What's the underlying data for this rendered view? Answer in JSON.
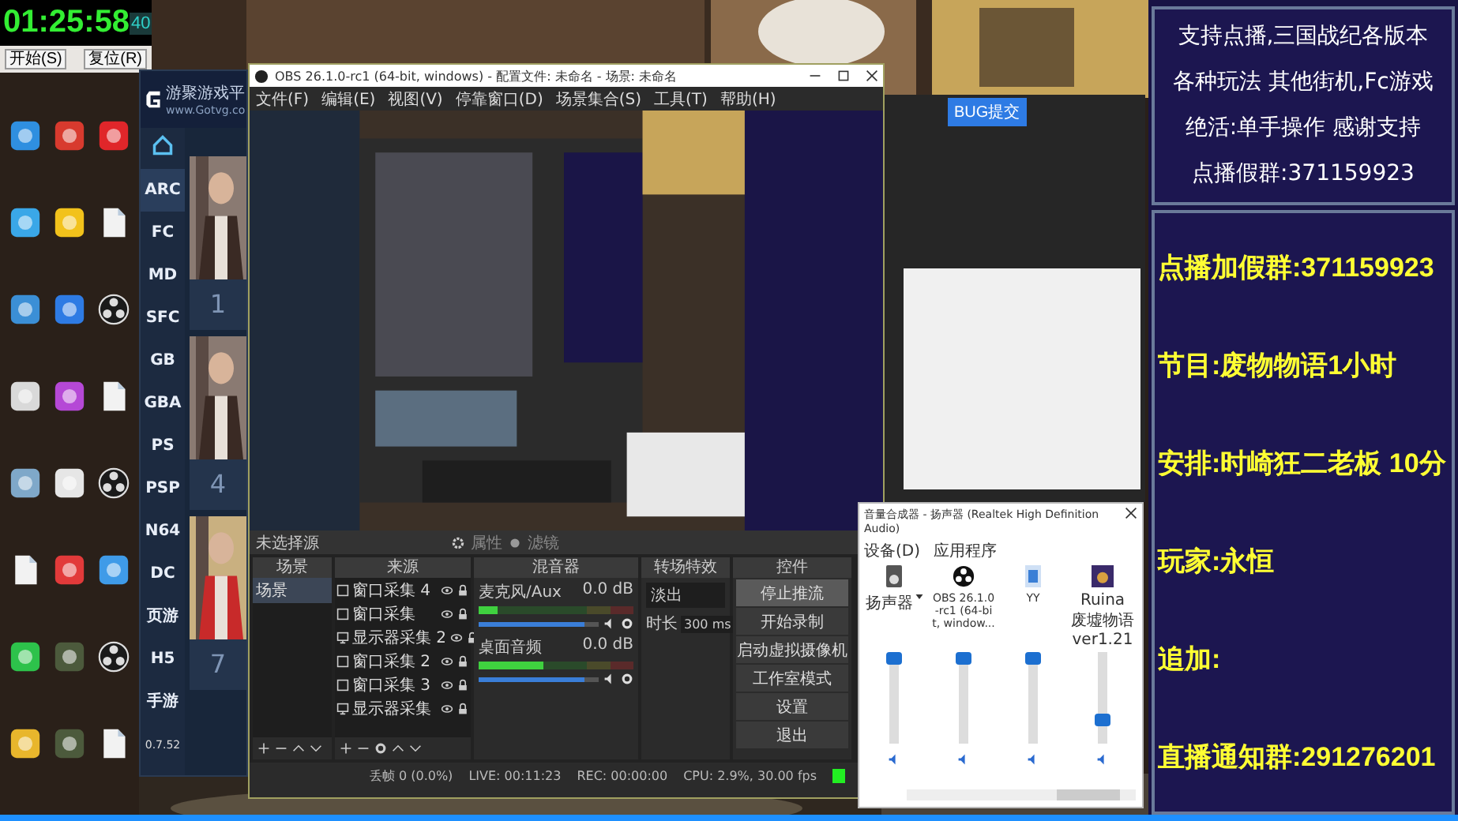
{
  "timer": {
    "time": "01:25:58",
    "count": "40",
    "buttons": [
      "开始(S)",
      "复位(R)"
    ]
  },
  "desktop_icons": [
    {
      "kind": "app",
      "color": "#2f8fe0"
    },
    {
      "kind": "app",
      "color": "#d83a2e"
    },
    {
      "kind": "app",
      "color": "#e0262a"
    },
    {
      "kind": "app",
      "color": "#3aa7e8"
    },
    {
      "kind": "app",
      "color": "#f2c21b"
    },
    {
      "kind": "doc"
    },
    {
      "kind": "app",
      "color": "#3b8fd6"
    },
    {
      "kind": "app",
      "color": "#2e7be4"
    },
    {
      "kind": "obs"
    },
    {
      "kind": "app",
      "color": "#d9d9d9"
    },
    {
      "kind": "app",
      "color": "#b548d6"
    },
    {
      "kind": "doc"
    },
    {
      "kind": "app",
      "color": "#7fa8c9"
    },
    {
      "kind": "app",
      "color": "#e6e6e6"
    },
    {
      "kind": "obs"
    },
    {
      "kind": "doc"
    },
    {
      "kind": "app",
      "color": "#e23a3a"
    },
    {
      "kind": "app",
      "color": "#3f9be8"
    },
    {
      "kind": "app",
      "color": "#2dc24b"
    },
    {
      "kind": "app",
      "color": "#4c5a3c"
    },
    {
      "kind": "obs"
    },
    {
      "kind": "app",
      "color": "#e8b62c"
    },
    {
      "kind": "app",
      "color": "#4c5a3c"
    },
    {
      "kind": "doc"
    }
  ],
  "launcher": {
    "title": "游聚游戏平",
    "url": "www.Gotvg.co",
    "nav": [
      {
        "label": "ARC",
        "selected": true
      },
      {
        "label": "FC",
        "selected": false
      },
      {
        "label": "MD",
        "selected": false
      },
      {
        "label": "SFC",
        "selected": false
      },
      {
        "label": "GB",
        "selected": false
      },
      {
        "label": "GBA",
        "selected": false
      },
      {
        "label": "PS",
        "selected": false
      },
      {
        "label": "PSP",
        "selected": false
      },
      {
        "label": "N64",
        "selected": false
      },
      {
        "label": "DC",
        "selected": false
      },
      {
        "label": "页游",
        "selected": false
      },
      {
        "label": "H5",
        "selected": false
      },
      {
        "label": "手游",
        "selected": false
      }
    ],
    "version": "0.7.52",
    "cards": [
      {
        "number": "1"
      },
      {
        "number": "4"
      },
      {
        "number": "7"
      }
    ]
  },
  "obs": {
    "title": "OBS 26.1.0-rc1 (64-bit, windows) - 配置文件: 未命名 - 场景: 未命名",
    "menu": [
      "文件(F)",
      "编辑(E)",
      "视图(V)",
      "停靠窗口(D)",
      "场景集合(S)",
      "工具(T)",
      "帮助(H)"
    ],
    "source_toolbar": {
      "label": "未选择源",
      "properties": "属性",
      "filters": "滤镜"
    },
    "docks": {
      "scenes": "场景",
      "sources": "来源",
      "mixer": "混音器",
      "transitions": "转场特效",
      "controls": "控件"
    },
    "scenes": [
      {
        "label": "场景",
        "selected": true
      }
    ],
    "sources": [
      {
        "kind": "window",
        "label": "窗口采集 4"
      },
      {
        "kind": "window",
        "label": "窗口采集"
      },
      {
        "kind": "display",
        "label": "显示器采集 2"
      },
      {
        "kind": "window",
        "label": "窗口采集 2"
      },
      {
        "kind": "window",
        "label": "窗口采集 3"
      },
      {
        "kind": "display",
        "label": "显示器采集"
      }
    ],
    "channels": [
      {
        "name": "麦克风/Aux",
        "reading": "0.0 dB",
        "meter": {
          "level": 0.12
        },
        "fader": {
          "level": 0.88
        }
      },
      {
        "name": "桌面音频",
        "reading": "0.0 dB",
        "meter": {
          "level": 0.42
        },
        "fader": {
          "level": 0.88
        }
      }
    ],
    "transition": {
      "type": "淡出",
      "duration_label": "时长",
      "duration": "300 ms"
    },
    "controls": [
      {
        "label": "停止推流",
        "highlighted": true
      },
      {
        "label": "开始录制",
        "highlighted": false
      },
      {
        "label": "启动虚拟摄像机",
        "highlighted": false
      },
      {
        "label": "工作室模式",
        "highlighted": false
      },
      {
        "label": "设置",
        "highlighted": false
      },
      {
        "label": "退出",
        "highlighted": false
      }
    ],
    "status": [
      "丢帧 0 (0.0%)",
      "LIVE: 00:11:23",
      "REC: 00:00:00",
      "CPU: 2.9%, 30.00 fps"
    ]
  },
  "chat_window": {
    "bug_button": "BUG提交"
  },
  "mixer": {
    "title": "音量合成器 - 扬声器 (Realtek High Definition Audio)",
    "device_header": "设备(D)",
    "apps_header": "应用程序",
    "channels": [
      {
        "kind": "device",
        "label": "扬声器",
        "level": 1
      },
      {
        "kind": "obs",
        "label": "OBS 26.1.0-rc1 (64-bit, window...",
        "level": 1
      },
      {
        "kind": "yy",
        "label": "YY",
        "level": 1
      },
      {
        "kind": "game",
        "label": "Ruina 废墟物语 ver1.21",
        "level": 0.22
      }
    ]
  },
  "info_panel": {
    "top_lines": [
      "支持点播,三国战纪各版本",
      "各种玩法 其他街机,Fc游戏",
      "绝活:单手操作 感谢支持",
      "点播假群:371159923"
    ],
    "bottom_lines": [
      "点播加假群:371159923",
      "节目:废物物语1小时",
      "安排:时崎狂二老板 10分",
      "玩家:永恒",
      "追加:",
      "直播通知群:291276201"
    ]
  }
}
